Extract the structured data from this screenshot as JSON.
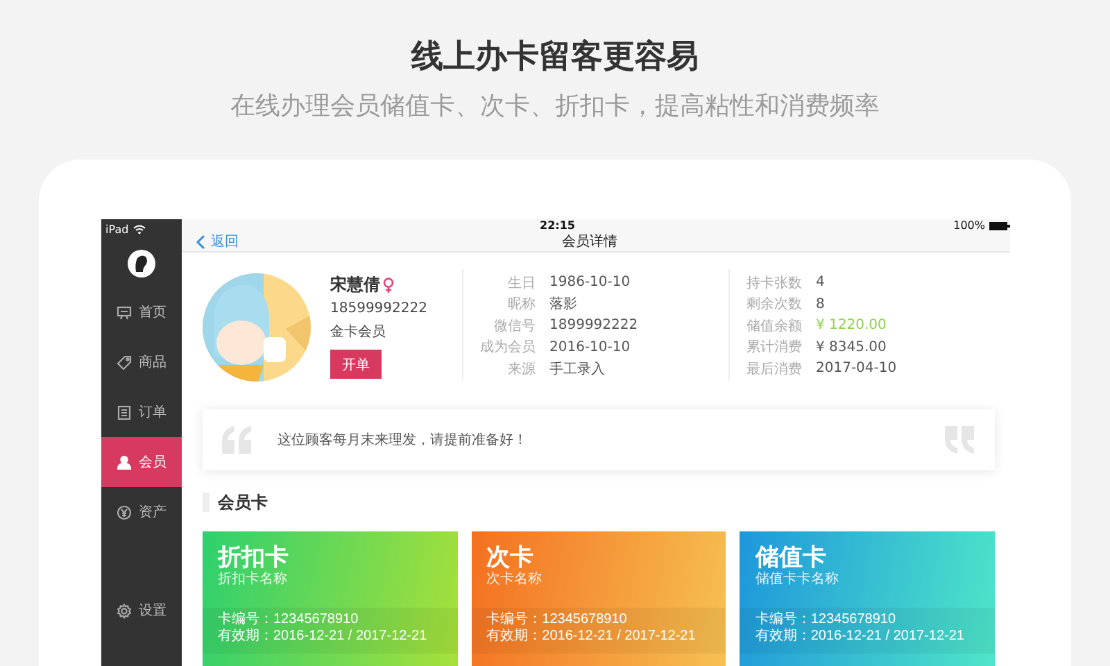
{
  "header": {
    "title": "线上办卡留客更容易",
    "subtitle": "在线办理会员储值卡、次卡、折扣卡，提高粘性和消费频率"
  },
  "status_bar": {
    "carrier": "iPad",
    "time": "22:15",
    "battery": "100%"
  },
  "sidebar": {
    "items": [
      {
        "label": "首页",
        "selected": false
      },
      {
        "label": "商品",
        "selected": false
      },
      {
        "label": "订单",
        "selected": false
      },
      {
        "label": "会员",
        "selected": true
      },
      {
        "label": "资产",
        "selected": false
      }
    ],
    "footer_item": {
      "label": "设置",
      "selected": false
    }
  },
  "nav_bar": {
    "back": "返回",
    "title": "会员详情"
  },
  "profile": {
    "name": "宋慧倩",
    "phone": "18599992222",
    "level": "金卡会员",
    "button": "开单"
  },
  "details": [
    [
      {
        "label": "生日",
        "value": "1986-10-10"
      },
      {
        "label": "昵称",
        "value": "落影"
      },
      {
        "label": "微信号",
        "value": "1899992222"
      },
      {
        "label": "成为会员",
        "value": "2016-10-10"
      },
      {
        "label": "来源",
        "value": "手工录入"
      }
    ],
    [
      {
        "label": "持卡张数",
        "value": "4",
        "highlighted": false
      },
      {
        "label": "剩余次数",
        "value": "8",
        "highlighted": false
      },
      {
        "label": "储值余额",
        "value": "¥ 1220.00",
        "highlighted": true
      },
      {
        "label": "累计消费",
        "value": "¥ 8345.00",
        "highlighted": false
      },
      {
        "label": "最后消费",
        "value": "2017-04-10",
        "highlighted": false
      }
    ]
  ],
  "note": "这位顾客每月末来理发，请提前准备好！",
  "section_title": "会员卡",
  "cards": [
    {
      "kind": "discount",
      "title": "折扣卡",
      "subtitle": "折扣卡名称",
      "number": "卡编号：12345678910",
      "validity": "有效期：2016-12-21 / 2017-12-21"
    },
    {
      "kind": "count",
      "title": "次卡",
      "subtitle": "次卡名称",
      "number": "卡编号：12345678910",
      "validity": "有效期：2016-12-21 / 2017-12-21"
    },
    {
      "kind": "stored",
      "title": "储值卡",
      "subtitle": "储值卡卡名称",
      "number": "卡编号：12345678910",
      "validity": "有效期：2016-12-21 / 2017-12-21"
    }
  ]
}
